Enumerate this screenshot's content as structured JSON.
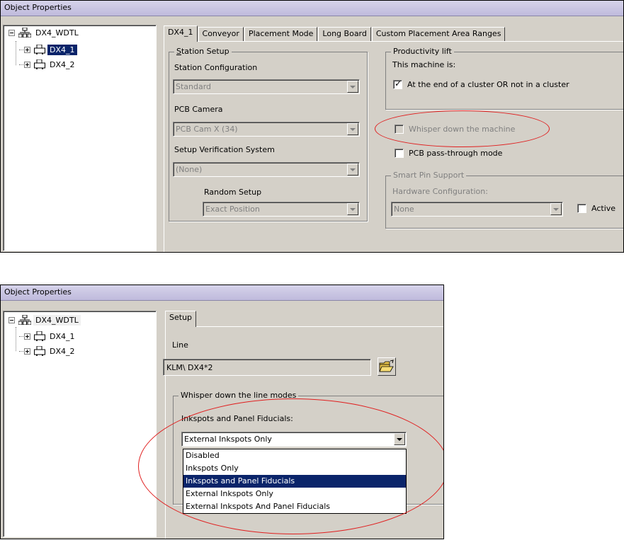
{
  "window_top": {
    "title": "Object Properties",
    "tree": {
      "root": "DX4_WDTL",
      "children": [
        "DX4_1",
        "DX4_2"
      ],
      "selected": "DX4_1"
    },
    "tabs": [
      "DX4_1",
      "Conveyor",
      "Placement Mode",
      "Long Board",
      "Custom Placement Area Ranges"
    ],
    "active_tab": "DX4_1",
    "station_setup": {
      "group_label": "Station Setup",
      "station_config_label": "Station Configuration",
      "station_config_value": "Standard",
      "pcb_camera_label": "PCB Camera",
      "pcb_camera_value": "PCB Cam X (34)",
      "setup_verification_label": "Setup Verification System",
      "setup_verification_value": "(None)",
      "random_setup_label": "Random Setup",
      "random_setup_value": "Exact Position"
    },
    "productivity": {
      "group_label": "Productivity lift",
      "machine_is_label": "This machine is:",
      "end_of_cluster_label": "At the end of a cluster OR not in a cluster",
      "end_of_cluster_checked": true
    },
    "whisper_machine_label": "Whisper down the machine",
    "pcb_passthrough_label": "PCB pass-through mode",
    "smart_pin": {
      "group_label": "Smart Pin Support",
      "hardware_config_label": "Hardware Configuration:",
      "hardware_config_value": "None",
      "active_label": "Active"
    }
  },
  "window_bottom": {
    "title": "Object Properties",
    "tree": {
      "root": "DX4_WDTL",
      "children": [
        "DX4_1",
        "DX4_2"
      ]
    },
    "tabs": [
      "Setup"
    ],
    "line_label": "Line",
    "line_value": "KLM\\ DX4*2",
    "whisper_group_label": "Whisper down the line modes",
    "inkspots_label": "Inkspots and Panel Fiducials:",
    "inkspots_value": "External Inkspots Only",
    "dropdown_options": [
      "Disabled",
      "Inkspots Only",
      "Inkspots and Panel Fiducials",
      "External Inkspots Only",
      "External Inkspots And Panel Fiducials"
    ],
    "highlighted_option": "Inkspots and Panel Fiducials"
  },
  "colors": {
    "selection": "#0a246a",
    "annotation": "#e02020",
    "face": "#d4d0c8"
  }
}
